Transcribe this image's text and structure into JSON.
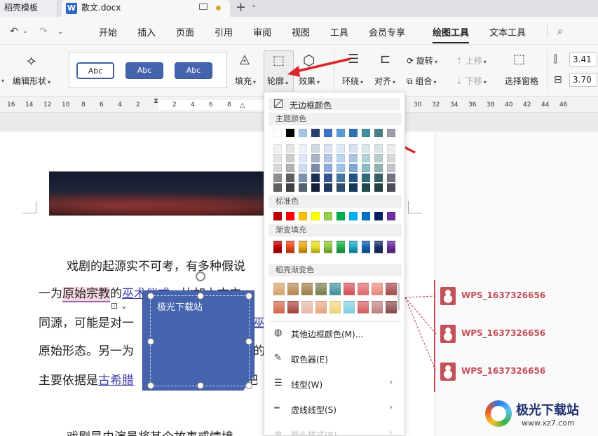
{
  "tabs": [
    {
      "label": "稻壳模板"
    },
    {
      "label": "散文.docx",
      "icon": "word-icon"
    }
  ],
  "menu": {
    "items": [
      "开始",
      "插入",
      "页面",
      "引用",
      "审阅",
      "视图",
      "工具",
      "会员专享",
      "绘图工具",
      "文本工具"
    ],
    "active": "绘图工具"
  },
  "ribbon": {
    "edit_shape": "编辑形状",
    "style_samples": [
      "Abc",
      "Abc",
      "Abc"
    ],
    "fill": "填充",
    "outline": "轮廓",
    "effect": "效果",
    "wrap": "环绕",
    "align": "对齐",
    "rotate": "旋转",
    "group": "组合",
    "move_up": "上移",
    "move_down": "下移",
    "selection_pane": "选择窗格",
    "height_value": "3.41",
    "width_value": "3.70"
  },
  "ruler": {
    "left_numbers": [
      "16",
      "14",
      "12",
      "10",
      "8",
      "6",
      "4",
      "2"
    ],
    "mid_numbers": [
      "2",
      "4",
      "6",
      "8"
    ],
    "right_numbers": [
      "30",
      "32",
      "34",
      "36",
      "38",
      "40",
      "42",
      "44",
      "46"
    ]
  },
  "document": {
    "lines": {
      "l1": "戏剧的起源实不可考，有多种假说",
      "l2_pre": "一为",
      "l2_pink": "原始宗教",
      "l2_mid": "的",
      "l2_link": "巫术仪式",
      "l2_post": "。比如上古中",
      "l3_pre": "同源，可能是对一",
      "l3_post": "巫",
      "l4_pre": "原始形态。另一为",
      "l4_post": "的",
      "l5_pre": "主要依据是",
      "l5_link": "古希腊",
      "l5_post": "把",
      "l6": "戏剧是由演员将某个故事或情境"
    },
    "shape_text": "极光下载站"
  },
  "comments": [
    "WPS_1637326656",
    "WPS_1637326656",
    "WPS_1637326656"
  ],
  "dropdown": {
    "no_outline": "无边框颜色",
    "theme_colors_title": "主题颜色",
    "standard_colors_title": "标准色",
    "gradient_fill_title": "渐变填充",
    "docer_gradient_title": "稻壳渐变色",
    "more_colors": "其他边框颜色(M)...",
    "eyedropper": "取色器(E)",
    "line_type": "线型(W)",
    "dash_type": "虚线线型(S)",
    "arrow_style": "箭头样式(R)",
    "theme_top_row": [
      "#ffffff",
      "#000000",
      "#a9c4eb",
      "#25406e",
      "#4472c4",
      "#5b9bd5",
      "#2f6fb5",
      "#3f8fa0",
      "#4a7f85",
      "#9e9aa8"
    ],
    "standard_colors": [
      "#c00000",
      "#ff0000",
      "#ffc000",
      "#ffff00",
      "#92d050",
      "#00b050",
      "#00b0f0",
      "#0070c0",
      "#002060",
      "#7030a0"
    ],
    "gradient_colors": [
      "#c00000",
      "#e84a1f",
      "#e6a817",
      "#e8e020",
      "#8fca3c",
      "#22b14c",
      "#1aa9c8",
      "#1461b2",
      "#1a2f6a",
      "#6a2d9a"
    ],
    "docer_row1": [
      "#d9a36a",
      "#b8874f",
      "#9c7b44",
      "#7a7a4a",
      "#3f8f9a",
      "#d44c55",
      "#e0656b",
      "#e8877a",
      "#a44848"
    ],
    "docer_row2": [
      "#d4674b",
      "#a8413b",
      "#e8b8a8",
      "#e6a87e",
      "#f0d47a",
      "#7fcfe0",
      "#d85a60",
      "#c08080",
      "#8a4848"
    ]
  },
  "watermark": {
    "name": "极光下载站",
    "url": "www.xz7.com"
  }
}
